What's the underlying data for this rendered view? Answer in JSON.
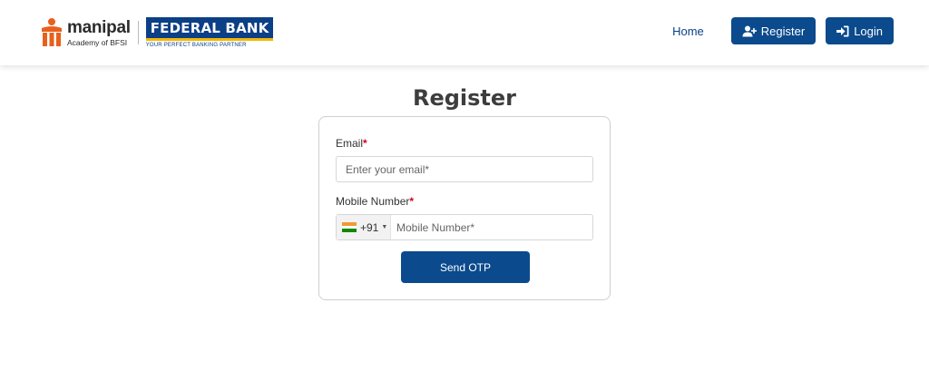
{
  "header": {
    "manipal_name": "manipal",
    "manipal_sub": "Academy of BFSI",
    "bank_name": "FEDERAL BANK",
    "bank_tagline": "YOUR PERFECT BANKING PARTNER",
    "nav": {
      "home": "Home",
      "register": "Register",
      "login": "Login"
    },
    "colors": {
      "primary": "#0b4a8c",
      "manipal_orange": "#e8601c",
      "fb_yellow": "#f2b705"
    }
  },
  "page": {
    "title": "Register"
  },
  "form": {
    "email_label": "Email",
    "email_placeholder": "Enter your email*",
    "mobile_label": "Mobile Number",
    "country_code": "+91",
    "country_flag": "india-flag",
    "mobile_placeholder": "Mobile Number*",
    "submit": "Send OTP",
    "required_mark": "*"
  }
}
